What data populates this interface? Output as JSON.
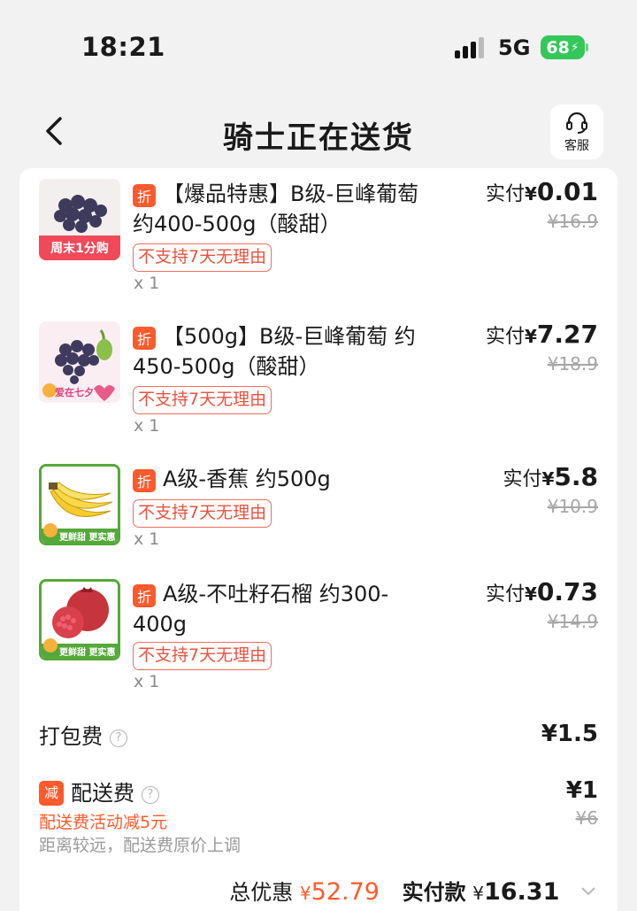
{
  "status_bar": {
    "time": "18:21",
    "network": "5G",
    "battery": "68"
  },
  "header": {
    "title": "骑士正在送货",
    "service_label": "客服"
  },
  "items": [
    {
      "discount": "折",
      "name": "【爆品特惠】B级-巨峰葡萄 约400-500g（酸甜）",
      "return_policy": "不支持7天无理由",
      "qty": "x 1",
      "price_label": "实付",
      "currency": "¥",
      "price": "0.01",
      "original_price": "¥16.9",
      "thumb_tag": "周末1分购"
    },
    {
      "discount": "折",
      "name": "【500g】B级-巨峰葡萄 约450-500g（酸甜）",
      "return_policy": "不支持7天无理由",
      "qty": "x 1",
      "price_label": "实付",
      "currency": "¥",
      "price": "7.27",
      "original_price": "¥18.9",
      "thumb_tag": "爱在七夕"
    },
    {
      "discount": "折",
      "name": "A级-香蕉 约500g",
      "return_policy": "不支持7天无理由",
      "qty": "x 1",
      "price_label": "实付",
      "currency": "¥",
      "price": "5.8",
      "original_price": "¥10.9",
      "thumb_tag": "更鲜甜 更实惠"
    },
    {
      "discount": "折",
      "name": "A级-不吐籽石榴 约300-400g",
      "return_policy": "不支持7天无理由",
      "qty": "x 1",
      "price_label": "实付",
      "currency": "¥",
      "price": "0.73",
      "original_price": "¥14.9",
      "thumb_tag": "更鲜甜 更实惠"
    }
  ],
  "packing_fee": {
    "label": "打包费",
    "value": "¥1.5"
  },
  "delivery_fee": {
    "badge": "减",
    "label": "配送费",
    "value": "¥1",
    "original": "¥6",
    "promo": "配送费活动减5元",
    "note": "距离较远，配送费原价上调"
  },
  "totals": {
    "discount_label": "总优惠",
    "discount_currency": "¥",
    "discount_value": "52.79",
    "pay_label": "实付款",
    "pay_currency": "¥",
    "pay_value": "16.31"
  },
  "colors": {
    "accent": "#ff5a2c",
    "battery": "#34c759",
    "return_tag": "#e8523f"
  }
}
